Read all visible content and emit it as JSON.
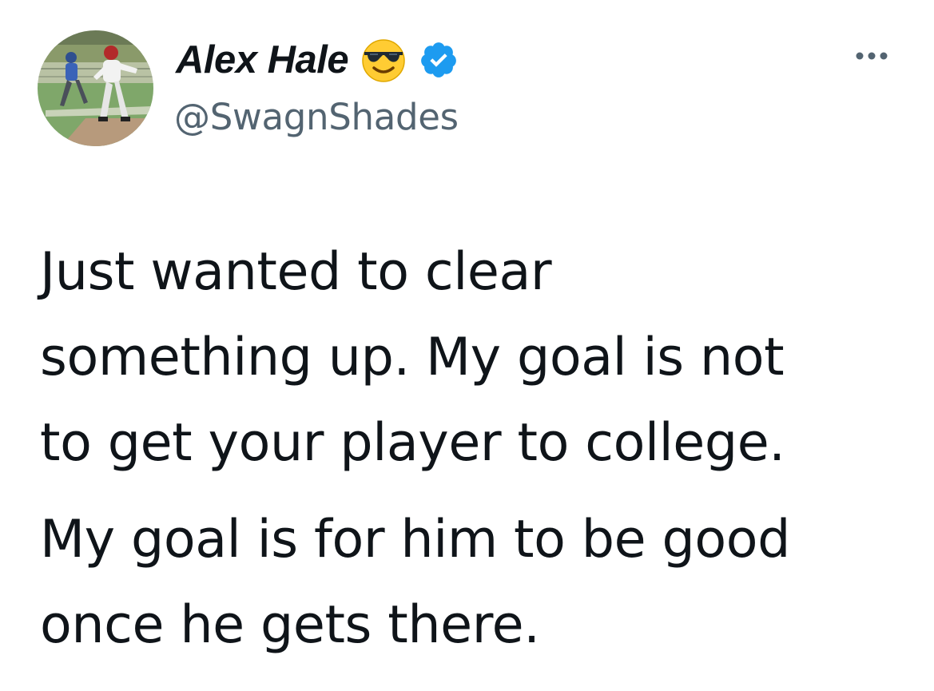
{
  "author": {
    "display_name": "Alex Hale",
    "handle": "@SwagnShades",
    "name_emoji_icon": "smiling-face-with-sunglasses-icon",
    "verified_icon": "verified-badge-icon",
    "verified_color": "#1d9bf0",
    "avatar_icon": "profile-photo-baseball-player"
  },
  "menu": {
    "more_icon": "more-options-icon"
  },
  "tweet": {
    "paragraphs": [
      {
        "lines": [
          "Just wanted to clear",
          "something up. My goal is not",
          "to get your player to college."
        ]
      },
      {
        "lines": [
          "My goal is for him to be good",
          "once he gets there."
        ]
      }
    ]
  },
  "colors": {
    "text_primary": "#0f1419",
    "text_secondary": "#536471",
    "background": "#ffffff"
  }
}
